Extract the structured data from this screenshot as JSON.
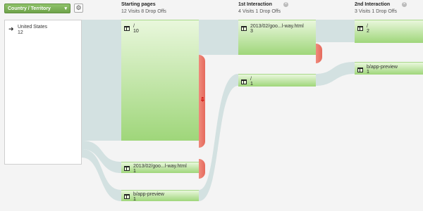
{
  "dimension": {
    "label": "Country / Territory",
    "chevron": "▾"
  },
  "settings": {
    "icon": "gear-icon",
    "glyph": "⚙"
  },
  "columns": [
    {
      "title": "Starting pages",
      "summary": "12 Visits 8 Drop Offs"
    },
    {
      "title": "1st Interaction",
      "summary": "4 Visits 1 Drop Offs"
    },
    {
      "title": "2nd Interaction",
      "summary": "3 Visits 1 Drop Offs"
    }
  ],
  "close_glyph": "×",
  "source": {
    "icon": "arrow-icon",
    "glyph": "➜",
    "label": "United States",
    "count": "12"
  },
  "nodes": {
    "start_root": {
      "label": "/",
      "count": "10"
    },
    "start_blog": {
      "label": "2013/02/goo...l-way.html",
      "count": "1"
    },
    "start_preview": {
      "label": "b/app-preview",
      "count": "1"
    },
    "first_blog": {
      "label": "2013/02/goo...l-way.html",
      "count": "3"
    },
    "first_root": {
      "label": "/",
      "count": "1"
    },
    "second_root": {
      "label": "/",
      "count": "2"
    },
    "second_preview": {
      "label": "b/app-preview",
      "count": "1"
    }
  },
  "drop_arrow": "⇩",
  "colors": {
    "flow": "#d3e1e1",
    "node_top": "#e9f7dc",
    "node_bottom": "#9fd67a",
    "drop": "#e56a5c",
    "accent": "#7ab356"
  }
}
